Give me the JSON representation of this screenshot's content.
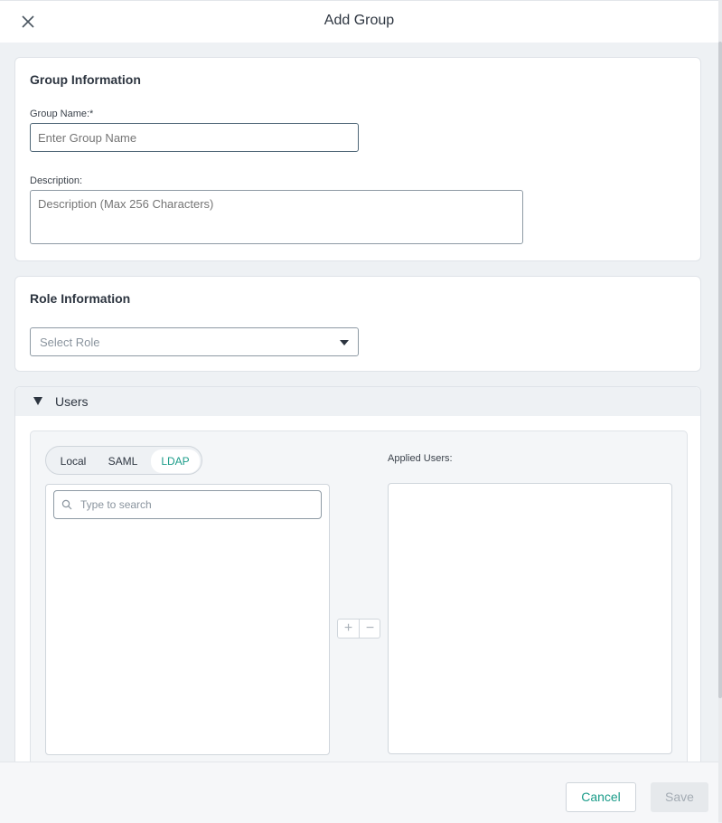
{
  "header": {
    "title": "Add Group"
  },
  "group_info": {
    "title": "Group Information",
    "name_label": "Group Name:*",
    "name_placeholder": "Enter Group Name",
    "name_value": "",
    "desc_label": "Description:",
    "desc_placeholder": "Description (Max 256 Characters)",
    "desc_value": ""
  },
  "role_info": {
    "title": "Role Information",
    "select_placeholder": "Select Role"
  },
  "users": {
    "title": "Users",
    "tabs": [
      {
        "label": "Local",
        "active": false
      },
      {
        "label": "SAML",
        "active": false
      },
      {
        "label": "LDAP",
        "active": true
      }
    ],
    "search_placeholder": "Type to search",
    "applied_label": "Applied Users:",
    "add_symbol": "+",
    "remove_symbol": "−"
  },
  "footer": {
    "cancel_label": "Cancel",
    "save_label": "Save"
  },
  "colors": {
    "accent": "#1a9c89",
    "background": "#eef1f4"
  }
}
